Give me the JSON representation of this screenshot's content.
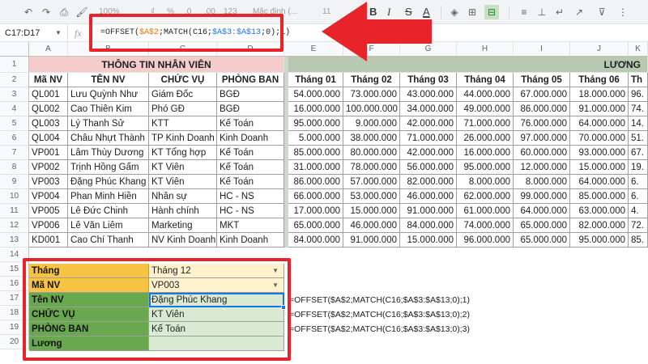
{
  "toolbar": {
    "zoom": "100%",
    "currency": "₫",
    "percent": "%",
    "dec_decrease": ".0",
    "dec_increase": ".00",
    "number_format": "123",
    "font_family": "Mặc định (...",
    "font_size": "11",
    "bold": "B",
    "italic": "I",
    "strikethrough": "S",
    "text_color": "A"
  },
  "formula_bar": {
    "name_box": "C17:D17",
    "fx": "fx",
    "formula": {
      "p1": "=OFFSET(",
      "p2": "$A$2",
      "p3": ";MATCH(C16;",
      "p4": "$A$3:$A$13",
      "p5": ";0);1)"
    }
  },
  "columns": [
    "A",
    "B",
    "C",
    "D",
    "E",
    "F",
    "G",
    "H",
    "I",
    "J",
    "K"
  ],
  "rows": [
    "1",
    "2",
    "3",
    "4",
    "5",
    "6",
    "7",
    "8",
    "9",
    "10",
    "11",
    "12",
    "13",
    "14",
    "15",
    "16",
    "17",
    "18",
    "19",
    "20"
  ],
  "employee_table": {
    "title": "THÔNG TIN NHÂN VIÊN",
    "headers": [
      "Mã NV",
      "TÊN NV",
      "CHỨC VỤ",
      "PHÒNG BAN"
    ],
    "rows": [
      [
        "QL001",
        "Lưu Quỳnh Như",
        "Giám Đốc",
        "BGĐ"
      ],
      [
        "QL002",
        "Cao Thiên Kim",
        "Phó GĐ",
        "BGĐ"
      ],
      [
        "QL003",
        "Lý Thanh Sử",
        "KTT",
        "Kế Toán"
      ],
      [
        "QL004",
        "Châu Nhựt Thành",
        "TP Kinh Doanh",
        "Kinh Doanh"
      ],
      [
        "VP001",
        "Lâm Thùy Dương",
        "KT Tổng hợp",
        "Kế Toán"
      ],
      [
        "VP002",
        "Trịnh Hồng Gấm",
        "KT Viên",
        "Kế Toán"
      ],
      [
        "VP003",
        "Đặng Phúc Khang",
        "KT Viên",
        "Kế Toán"
      ],
      [
        "VP004",
        "Phan Minh Hiền",
        "Nhân sự",
        "HC - NS"
      ],
      [
        "VP005",
        "Lê Đức Chinh",
        "Hành chính",
        "HC - NS"
      ],
      [
        "VP006",
        "Lê Văn Liêm",
        "Marketing",
        "MKT"
      ],
      [
        "KD001",
        "Cao Chí Thanh",
        "NV Kinh Doanh",
        "Kinh Doanh"
      ]
    ]
  },
  "salary_table": {
    "title": "LƯƠNG",
    "headers": [
      "Tháng 01",
      "Tháng 02",
      "Tháng 03",
      "Tháng 04",
      "Tháng 05",
      "Tháng 06",
      "Th"
    ],
    "rows": [
      [
        "54.000.000",
        "73.000.000",
        "43.000.000",
        "44.000.000",
        "67.000.000",
        "18.000.000",
        "96."
      ],
      [
        "16.000.000",
        "100.000.000",
        "34.000.000",
        "49.000.000",
        "86.000.000",
        "91.000.000",
        "74."
      ],
      [
        "95.000.000",
        "9.000.000",
        "42.000.000",
        "71.000.000",
        "76.000.000",
        "64.000.000",
        "14."
      ],
      [
        "5.000.000",
        "38.000.000",
        "71.000.000",
        "26.000.000",
        "97.000.000",
        "70.000.000",
        "51."
      ],
      [
        "85.000.000",
        "80.000.000",
        "42.000.000",
        "16.000.000",
        "60.000.000",
        "93.000.000",
        "67."
      ],
      [
        "31.000.000",
        "78.000.000",
        "56.000.000",
        "95.000.000",
        "12.000.000",
        "15.000.000",
        "19."
      ],
      [
        "86.000.000",
        "57.000.000",
        "82.000.000",
        "8.000.000",
        "8.000.000",
        "64.000.000",
        "6."
      ],
      [
        "66.000.000",
        "53.000.000",
        "46.000.000",
        "62.000.000",
        "99.000.000",
        "85.000.000",
        "6."
      ],
      [
        "17.000.000",
        "15.000.000",
        "91.000.000",
        "61.000.000",
        "64.000.000",
        "63.000.000",
        "4."
      ],
      [
        "65.000.000",
        "46.000.000",
        "84.000.000",
        "74.000.000",
        "65.000.000",
        "82.000.000",
        "72."
      ],
      [
        "84.000.000",
        "91.000.000",
        "15.000.000",
        "96.000.000",
        "65.000.000",
        "95.000.000",
        "85."
      ]
    ]
  },
  "lookup": {
    "thang_label": "Tháng",
    "thang_value": "Tháng 12",
    "manv_label": "Mã NV",
    "manv_value": "VP003",
    "tennv_label": "Tên NV",
    "tennv_value": "Đặng Phúc Khang",
    "chucvu_label": "CHỨC VỤ",
    "chucvu_value": "KT Viên",
    "phongban_label": "PHÒNG BAN",
    "phongban_value": "Kế Toán",
    "luong_label": "Lương",
    "luong_value": ""
  },
  "formula_notes": [
    "=OFFSET($A$2;MATCH(C16;$A$3:$A$13;0);1)",
    "=OFFSET($A$2;MATCH(C16;$A$3:$A$13;0);2)",
    "=OFFSET($A$2;MATCH(C16;$A$3:$A$13;0);3)"
  ],
  "colors": {
    "highlight_red": "#e8232a",
    "title_pink": "#f4cccc",
    "luong_green": "#b7c9b1",
    "label_green": "#6aa84f",
    "label_yellow": "#f6c342",
    "selection_blue": "#1a73e8"
  }
}
